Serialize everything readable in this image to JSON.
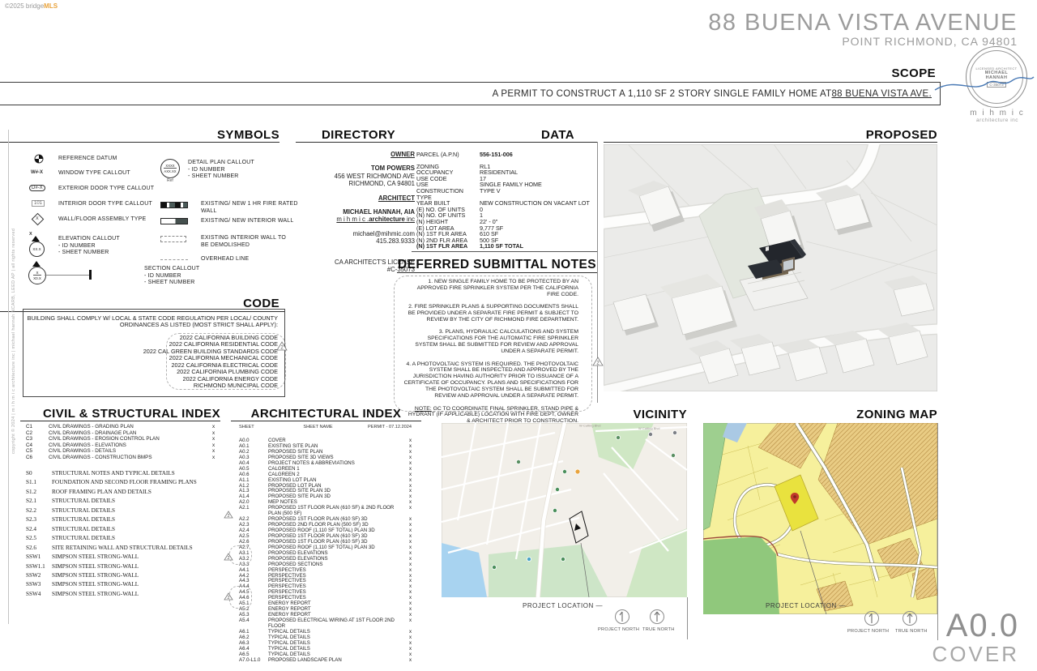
{
  "page": {
    "logo_copyright": "©2025 bridge",
    "logo_mls": "MLS",
    "title": "88 BUENA VISTA AVENUE",
    "subtitle": "POINT RICHMOND, CA 94801",
    "sheet_number": "A0.0",
    "sheet_title": "COVER",
    "side_copyright": "copyright © 2024 | m i h m i c architecture inc | michael hannah NCARB, LEED AP | all rights reserved"
  },
  "scope": {
    "heading": "SCOPE",
    "text": "A PERMIT TO CONSTRUCT A 1,110 SF 2 STORY SINGLE FAMILY HOME AT ",
    "address": "88 BUENA VISTA AVE."
  },
  "seal": {
    "ring_top": "LICENSED ARCHITECT",
    "name_line1": "MICHAEL",
    "name_line2": "HANNAH",
    "license": "C-35073",
    "firm_name": "m i h m i c",
    "firm_sub": "architecture inc"
  },
  "symbols": {
    "heading": "SYMBOLS",
    "ref_datum": "REFERENCE DATUM",
    "window_tag": "W#-X",
    "window": "WINDOW TYPE CALLOUT",
    "ext_door_tag": "D#-X",
    "ext_door": "EXTERIOR DOOR TYPE CALLOUT",
    "int_door_tag": "101",
    "int_door": "INTERIOR DOOR TYPE CALLOUT",
    "wall_tag": "X",
    "wall": "WALL/FLOOR ASSEMBLY TYPE",
    "elev_id": "X",
    "elev_sheet": "XX.X",
    "elev_l1": "ELEVATION CALLOUT",
    "elev_l2": "- ID NUMBER",
    "elev_l3": "- SHEET NUMBER",
    "sect_id": "X",
    "sect_sheet": "X0.X",
    "sect_l1": "SECTION CALLOUT",
    "sect_l2": "- ID NUMBER",
    "sect_l3": "- SHEET NUMBER",
    "detail_id": "XXXX",
    "detail_sheet": "AXX.XX",
    "detail_ref": "Ref",
    "detail_l1": "DETAIL PLAN CALLOUT",
    "detail_l2": "- ID NUMBER",
    "detail_l3": "- SHEET NUMBER",
    "fire_wall_l1": "EXISTING/ NEW 1 HR FIRE RATED",
    "fire_wall_l2": "WALL",
    "int_wall": "EXISTING/ NEW INTERIOR WALL",
    "demo_l1": "EXISTING INTERIOR WALL TO",
    "demo_l2": "BE DEMOLISHED",
    "overhead": "OVERHEAD LINE"
  },
  "directory": {
    "heading": "DIRECTORY",
    "owner_label": "OWNER",
    "owner_name": "TOM POWERS",
    "owner_addr1": "456 WEST RICHMOND AVE",
    "owner_addr2": "RICHMOND, CA 94801",
    "architect_label": "ARCHITECT",
    "architect_name": "MICHAEL HANNAH, AIA",
    "firm_prefix": "m i h m i c .",
    "firm_bold": "architecture",
    "firm_suffix": " inc",
    "email": "michael@mihmic.com",
    "phone": "415.283.9333",
    "license_l1": "CA ARCHITECT'S LICENSE",
    "license_l2": "#C-35073"
  },
  "data_section": {
    "heading": "DATA",
    "rows": [
      {
        "label": "PARCEL (A.P.N)",
        "value": "556-151-006",
        "value_bold": true,
        "gap_after": true
      },
      {
        "label": "ZONING",
        "value": "RL1"
      },
      {
        "label": "OCCUPANCY",
        "value": "RESIDENTIAL"
      },
      {
        "label": "USE CODE",
        "value": "17"
      },
      {
        "label": "USE",
        "value": "SINGLE FAMILY HOME"
      },
      {
        "label": "CONSTRUCTION TYPE",
        "value": "TYPE V"
      },
      {
        "label": "YEAR BUILT",
        "value": "NEW CONSTRUCTION ON VACANT LOT"
      },
      {
        "label": "(E) NO. OF UNITS",
        "value": "0"
      },
      {
        "label": "(N) NO. OF UNITS",
        "value": "1"
      },
      {
        "label": "(N) HEIGHT",
        "value": "22' - 0\""
      },
      {
        "label": "(E) LOT AREA",
        "value": "9,777 SF"
      },
      {
        "label": "(N) 1ST FLR AREA",
        "value": "610 SF"
      },
      {
        "label": "(N) 2ND FLR AREA",
        "value": "500 SF"
      },
      {
        "label": "(N) 1ST FLR AREA",
        "value": "1,110 SF TOTAL",
        "label_bold": true,
        "value_bold": true
      }
    ]
  },
  "deferred": {
    "heading": "DEFERRED SUBMITTAL NOTES",
    "notes": [
      "1. NEW SINGLE FAMILY HOME TO BE PROTECTED BY AN APPROVED FIRE SPRINKLER SYSTEM PER THE CALIFORNIA FIRE CODE.",
      "2. FIRE SPRINKLER PLANS & SUPPORTING DOCUMENTS SHALL BE PROVIDED UNDER A SEPARATE FIRE PERMIT & SUBJECT TO REVIEW BY THE CITY OF RICHMOND FIRE DEPARTMENT.",
      "3. PLANS, HYDRAULIC CALCULATIONS AND SYSTEM SPECIFICATIONS FOR THE AUTOMATIC FIRE SPRINKLER SYSTEM SHALL BE SUBMITTED FOR REVIEW AND APPROVAL UNDER A SEPARATE PERMIT.",
      "4. A PHOTOVOLTAIC SYSTEM IS REQUIRED. THE PHOTOVOLTAIC SYSTEM SHALL BE INSPECTED AND APPROVED BY THE JURISDICTION HAVING AUTHORITY PRIOR TO ISSUANCE OF A CERTIFICATE OF OCCUPANCY. PLANS AND SPECIFICATIONS FOR THE PHOTOVOLTAIC SYSTEM SHALL BE SUBMITTED FOR REVIEW AND APPROVAL UNDER A SEPARATE PERMIT."
    ],
    "footer_label": "NOTE:",
    "footer_text": " GC TO COORDINATE FINAL SPRINKLER, STAND PIPE & HYDRANT (IF APPLICABLE) LOCATION WITH FIRE DEPT, OWNER & ARCHITECT PRIOR TO CONSTRUCTION."
  },
  "code_section": {
    "heading": "CODE",
    "intro": "BUILDING SHALL COMPLY W/ LOCAL & STATE CODE REGULATION PER LOCAL/ COUNTY ORDINANCES AS LISTED (MOST STRICT SHALL APPLY):",
    "codes": [
      "2022 CALIFORNIA BUILDING CODE",
      "2022 CALIFORNIA RESIDENTIAL CODE",
      "2022 CAL GREEN BUILDING STANDARDS CODE",
      "2022 CALIFORNIA MECHANICAL CODE",
      "2022 CALIFORNIA ELECTRICAL CODE",
      "2022 CALIFORNIA PLUMBING CODE",
      "2022 CALIFORNIA ENERGY CODE",
      "RICHMOND MUNICIPAL CODE"
    ]
  },
  "civil_index": {
    "heading": "CIVIL & STRUCTURAL INDEX",
    "civil_rows": [
      {
        "id": "C1",
        "name": "CIVIL DRAWINGS - GRADING PLAN",
        "mark": "x"
      },
      {
        "id": "C2",
        "name": "CIVIL DRAWINGS - DRAINAGE PLAN",
        "mark": "x"
      },
      {
        "id": "C3",
        "name": "CIVIL DRAWINGS - EROSION CONTROL PLAN",
        "mark": "x"
      },
      {
        "id": "C4",
        "name": "CIVIL DRAWINGS - ELEVATIONS",
        "mark": "x"
      },
      {
        "id": "C5",
        "name": "CIVIL DRAWINGS - DETAILS",
        "mark": "x"
      },
      {
        "id": "C6",
        "name": "CIVIL DRAWINGS - CONSTRUCTION BMPS",
        "mark": "x"
      }
    ],
    "structural_rows": [
      {
        "id": "S0",
        "name": "STRUCTURAL NOTES AND TYPICAL DETAILS"
      },
      {
        "id": "S1.1",
        "name": "FOUNDATION AND SECOND FLOOR FRAMING PLANS"
      },
      {
        "id": "S1.2",
        "name": "ROOF FRAMING PLAN AND DETAILS"
      },
      {
        "id": "S2.1",
        "name": "STRUCTURAL DETAILS"
      },
      {
        "id": "S2.2",
        "name": "STRUCTURAL DETAILS"
      },
      {
        "id": "S2.3",
        "name": "STRUCTURAL DETAILS"
      },
      {
        "id": "S2.4",
        "name": "STRUCTURAL DETAILS"
      },
      {
        "id": "S2.5",
        "name": "STRUCTURAL DETAILS"
      },
      {
        "id": "S2.6",
        "name": "SITE RETAINING WALL AND STRUCTURAL DETAILS"
      },
      {
        "id": "SSW1",
        "name": "SIMPSON STEEL STRONG-WALL"
      },
      {
        "id": "SSW1.1",
        "name": "SIMPSON STEEL STRONG-WALL"
      },
      {
        "id": "SSW2",
        "name": "SIMPSON STEEL STRONG-WALL"
      },
      {
        "id": "SSW3",
        "name": "SIMPSON STEEL STRONG-WALL"
      },
      {
        "id": "SSW4",
        "name": "SIMPSON STEEL STRONG-WALL"
      }
    ]
  },
  "arch_index": {
    "heading": "ARCHITECTURAL INDEX",
    "col_sheet": "SHEET",
    "col_name": "SHEET NAME",
    "col_permit": "PERMIT - 07.12.2024",
    "rows": [
      {
        "id": "A0.0",
        "name": "COVER",
        "mark": "x"
      },
      {
        "id": "A0.1",
        "name": "EXISTING SITE PLAN",
        "mark": "x"
      },
      {
        "id": "A0.2",
        "name": "PROPOSED SITE PLAN",
        "mark": "x"
      },
      {
        "id": "A0.3",
        "name": "PROPOSED SITE 3D VIEWS",
        "mark": "x"
      },
      {
        "id": "A0.4",
        "name": "PROJECT NOTES & ABBREVIATIONS",
        "mark": "x"
      },
      {
        "id": "A0.5",
        "name": "CALGREEN 1",
        "mark": "x"
      },
      {
        "id": "A0.6",
        "name": "CALGREEN 2",
        "mark": "x"
      },
      {
        "id": "A1.1",
        "name": "EXISTING LOT PLAN",
        "mark": "x"
      },
      {
        "id": "A1.2",
        "name": "PROPOSED LOT PLAN",
        "mark": "x"
      },
      {
        "id": "A1.3",
        "name": "PROPOSED SITE PLAN 3D",
        "mark": "x"
      },
      {
        "id": "A1.4",
        "name": "PROPOSED SITE PLAN 3D",
        "mark": "x"
      },
      {
        "id": "A2.0",
        "name": "MEP NOTES",
        "mark": "x"
      },
      {
        "id": "A2.1",
        "name": "PROPOSED 1ST FLOOR PLAN (610 SF) & 2ND FLOOR PLAN (500 SF)",
        "mark": "x"
      },
      {
        "id": "A2.2",
        "name": "PROPOSED 1ST FLOOR PLAN (610 SF) 3D",
        "mark": "x"
      },
      {
        "id": "A2.3",
        "name": "PROPOSED 2ND FLOOR PLAN (500 SF) 3D",
        "mark": "x"
      },
      {
        "id": "A2.4",
        "name": "PROPOSED ROOF (1,110 SF TOTAL) PLAN 3D",
        "mark": "x"
      },
      {
        "id": "A2.5",
        "name": "PROPOSED 1ST FLOOR PLAN (610 SF) 3D",
        "mark": "x"
      },
      {
        "id": "A2.6",
        "name": "PROPOSED 1ST FLOOR PLAN (610 SF) 3D",
        "mark": "x"
      },
      {
        "id": "A2.7",
        "name": "PROPOSED ROOF (1,110 SF TOTAL) PLAN 3D",
        "mark": "x"
      },
      {
        "id": "A3.1",
        "name": "PROPOSED ELEVATIONS",
        "mark": "x"
      },
      {
        "id": "A3.2",
        "name": "PROPOSED ELEVATIONS",
        "mark": "x"
      },
      {
        "id": "A3.3",
        "name": "PROPOSED SECTIONS",
        "mark": "x"
      },
      {
        "id": "A4.1",
        "name": "PERSPECTIVES",
        "mark": "x"
      },
      {
        "id": "A4.2",
        "name": "PERSPECTIVES",
        "mark": "x"
      },
      {
        "id": "A4.3",
        "name": "PERSPECTIVES",
        "mark": "x"
      },
      {
        "id": "A4.4",
        "name": "PERSPECTIVES",
        "mark": "x"
      },
      {
        "id": "A4.5",
        "name": "PERSPECTIVES",
        "mark": "x"
      },
      {
        "id": "A4.6",
        "name": "PERSPECTIVES",
        "mark": "x"
      },
      {
        "id": "A5.1",
        "name": "ENERGY REPORT",
        "mark": "x"
      },
      {
        "id": "A5.2",
        "name": "ENERGY REPORT",
        "mark": "x"
      },
      {
        "id": "A5.3",
        "name": "ENERGY REPORT",
        "mark": "x"
      },
      {
        "id": "A5.4",
        "name": "PROPOSED ELECTRICAL WIRING AT 1ST FLOOR 2ND FLOOR",
        "mark": "x"
      },
      {
        "id": "A6.1",
        "name": "TYPICAL DETAILS",
        "mark": "x"
      },
      {
        "id": "A6.2",
        "name": "TYPICAL DETAILS",
        "mark": "x"
      },
      {
        "id": "A6.3",
        "name": "TYPICAL DETAILS",
        "mark": "x"
      },
      {
        "id": "A6.4",
        "name": "TYPICAL DETAILS",
        "mark": "x"
      },
      {
        "id": "A6.5",
        "name": "TYPICAL DETAILS",
        "mark": "x"
      },
      {
        "id": "A7.0-L1.0",
        "name": "PROPOSED LANDSCAPE PLAN",
        "mark": "x"
      }
    ]
  },
  "vicinity": {
    "heading": "VICINITY",
    "project_location": "PROJECT LOCATION",
    "project_north": "PROJECT NORTH",
    "true_north": "TRUE NORTH",
    "map_label_1": "W Cutting Blvd",
    "map_label_2": "W Cutting Blvd"
  },
  "zoning": {
    "heading": "ZONING MAP",
    "project_location": "PROJECT LOCATION",
    "project_north": "PROJECT NORTH",
    "true_north": "TRUE NORTH"
  },
  "proposed": {
    "heading": "PROPOSED"
  },
  "revisions": {
    "number": "2"
  }
}
